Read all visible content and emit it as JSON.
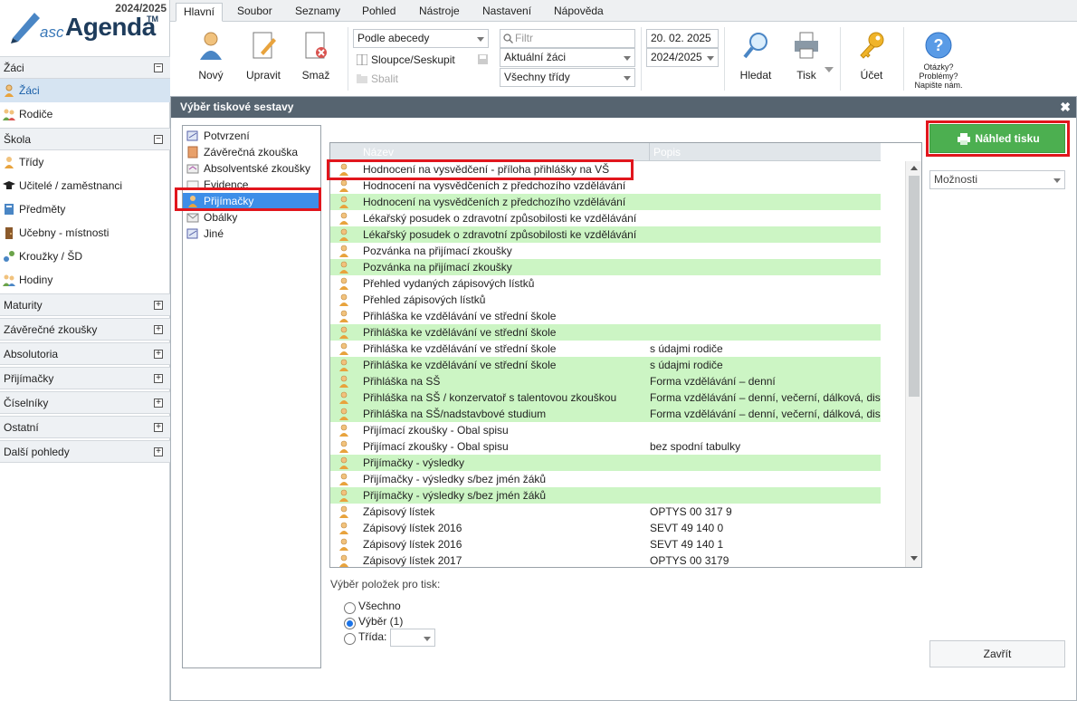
{
  "app": {
    "logo_asc": "asc",
    "logo_agenda": "Agenda",
    "logo_tm": "TM",
    "year": "2024/2025"
  },
  "sidebar": {
    "sections": [
      {
        "label": "Žáci",
        "toggle": "−"
      },
      {
        "label": "Škola",
        "toggle": "−"
      },
      {
        "label": "Maturity",
        "toggle": "+"
      },
      {
        "label": "Závěrečné zkoušky",
        "toggle": "+"
      },
      {
        "label": "Absolutoria",
        "toggle": "+"
      },
      {
        "label": "Přijímačky",
        "toggle": "+"
      },
      {
        "label": "Číselníky",
        "toggle": "+"
      },
      {
        "label": "Ostatní",
        "toggle": "+"
      },
      {
        "label": "Další pohledy",
        "toggle": "+"
      }
    ],
    "zaci_items": [
      {
        "label": "Žáci",
        "icon": "student-icon"
      },
      {
        "label": "Rodiče",
        "icon": "parents-icon"
      }
    ],
    "skola_items": [
      {
        "label": "Třídy",
        "icon": "class-icon"
      },
      {
        "label": "Učitelé / zaměstnanci",
        "icon": "teacher-icon"
      },
      {
        "label": "Předměty",
        "icon": "subject-icon"
      },
      {
        "label": "Učebny - místnosti",
        "icon": "room-icon"
      },
      {
        "label": "Kroužky / ŠD",
        "icon": "club-icon"
      },
      {
        "label": "Hodiny",
        "icon": "lessons-icon"
      }
    ]
  },
  "tabs": [
    "Hlavní",
    "Soubor",
    "Seznamy",
    "Pohled",
    "Nástroje",
    "Nastavení",
    "Nápověda"
  ],
  "toolbar": {
    "new_label": "Nový",
    "edit_label": "Upravit",
    "delete_label": "Smaž",
    "sort_value": "Podle abecedy",
    "columns_label": "Sloupce/Seskupit",
    "collapse_label": "Sbalit",
    "filter_placeholder": "Filtr",
    "students_value": "Aktuální žáci",
    "classes_value": "Všechny třídy",
    "date_value": "20. 02. 2025",
    "year_value": "2024/2025",
    "search_label": "Hledat",
    "print_label": "Tisk",
    "account_label": "Účet",
    "help_line1": "Otázky?",
    "help_line2": "Problémy?",
    "help_line3": "Napište nám."
  },
  "dialog": {
    "title": "Výběr tiskové sestavy",
    "close": "✖",
    "categories": [
      {
        "label": "Potvrzení",
        "icon": "certificate-icon"
      },
      {
        "label": "Závěrečná zkouška",
        "icon": "exam-book-icon"
      },
      {
        "label": "Absolventské zkoušky",
        "icon": "graduation-icon"
      },
      {
        "label": "Evidence",
        "icon": "records-icon"
      },
      {
        "label": "Přijímačky",
        "icon": "admission-icon"
      },
      {
        "label": "Obálky",
        "icon": "envelope-icon"
      },
      {
        "label": "Jiné",
        "icon": "other-icon"
      }
    ],
    "col_name": "Název",
    "col_desc": "Popis",
    "rows": [
      {
        "name": "Hodnocení na vysvědčení - příloha přihlášky na VŠ",
        "desc": "",
        "green": false
      },
      {
        "name": "Hodnocení na vysvědčeních z předchozího vzdělávání",
        "desc": "",
        "green": false
      },
      {
        "name": "Hodnocení na vysvědčeních z předchozího vzdělávání",
        "desc": "",
        "green": true
      },
      {
        "name": "Lékařský posudek o zdravotní způsobilosti ke vzdělávání",
        "desc": "",
        "green": false
      },
      {
        "name": "Lékařský posudek o zdravotní způsobilosti ke vzdělávání",
        "desc": "",
        "green": true
      },
      {
        "name": "Pozvánka na přijímací zkoušky",
        "desc": "",
        "green": false
      },
      {
        "name": "Pozvánka na přijímací zkoušky",
        "desc": "",
        "green": true
      },
      {
        "name": "Přehled vydaných zápisových lístků",
        "desc": "",
        "green": false
      },
      {
        "name": "Přehled zápisových lístků",
        "desc": "",
        "green": false
      },
      {
        "name": "Přihláška ke vzdělávání ve střední škole",
        "desc": "",
        "green": false
      },
      {
        "name": "Přihláška ke vzdělávání ve střední škole",
        "desc": "",
        "green": true
      },
      {
        "name": "Přihláška ke vzdělávání ve střední škole",
        "desc": "s údajmi rodiče",
        "green": false
      },
      {
        "name": "Přihláška ke vzdělávání ve střední škole",
        "desc": "s údajmi rodiče",
        "green": true
      },
      {
        "name": "Přihláška na SŠ",
        "desc": "Forma vzdělávání – denní",
        "green": true
      },
      {
        "name": "Přihláška na SŠ / konzervatoř s talentovou zkouškou",
        "desc": "Forma vzdělávání – denní, večerní, dálková, distanční",
        "green": true
      },
      {
        "name": "Přihláška na SŠ/nadstavbové studium",
        "desc": "Forma vzdělávání – denní, večerní, dálková, distanční",
        "green": true
      },
      {
        "name": "Přijímací zkoušky - Obal spisu",
        "desc": "",
        "green": false
      },
      {
        "name": "Přijímací zkoušky - Obal spisu",
        "desc": "bez spodní tabulky",
        "green": false
      },
      {
        "name": "Přijímačky - výsledky",
        "desc": "",
        "green": true
      },
      {
        "name": "Přijímačky - výsledky s/bez jmén žáků",
        "desc": "",
        "green": false
      },
      {
        "name": "Přijímačky - výsledky s/bez jmén žáků",
        "desc": "",
        "green": true
      },
      {
        "name": "Zápisový lístek",
        "desc": "OPTYS 00 317 9",
        "green": false
      },
      {
        "name": "Zápisový lístek 2016",
        "desc": "SEVT 49 140 0",
        "green": false
      },
      {
        "name": "Zápisový lístek 2016",
        "desc": "SEVT 49 140 1",
        "green": false
      },
      {
        "name": "Zápisový lístek 2017",
        "desc": "OPTYS 00 3179",
        "green": false
      }
    ],
    "preview_label": "Náhled tisku",
    "options_value": "Možnosti",
    "selection_title": "Výběr položek pro tisk:",
    "opt_all": "Všechno",
    "opt_selection": "Výběr (1)",
    "opt_class": "Třída:",
    "close_label": "Zavřít"
  },
  "colors": {
    "highlight": "#e1161d",
    "green_row": "#ccf5c4",
    "preview_button": "#4caf50",
    "selected_cat": "#3d8ee8"
  }
}
